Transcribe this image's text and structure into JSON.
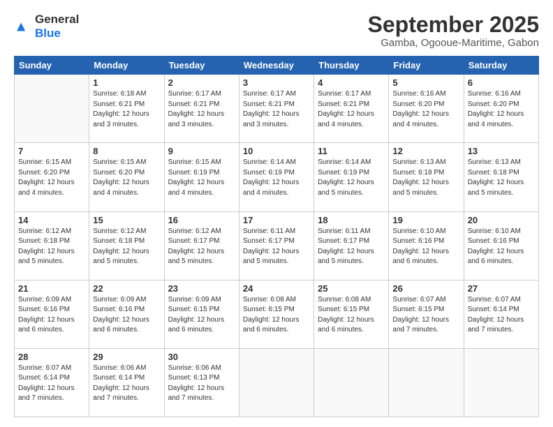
{
  "logo": {
    "general": "General",
    "blue": "Blue"
  },
  "title": "September 2025",
  "subtitle": "Gamba, Ogooue-Maritime, Gabon",
  "days": [
    "Sunday",
    "Monday",
    "Tuesday",
    "Wednesday",
    "Thursday",
    "Friday",
    "Saturday"
  ],
  "weeks": [
    [
      {
        "day": "",
        "info": ""
      },
      {
        "day": "1",
        "info": "Sunrise: 6:18 AM\nSunset: 6:21 PM\nDaylight: 12 hours\nand 3 minutes."
      },
      {
        "day": "2",
        "info": "Sunrise: 6:17 AM\nSunset: 6:21 PM\nDaylight: 12 hours\nand 3 minutes."
      },
      {
        "day": "3",
        "info": "Sunrise: 6:17 AM\nSunset: 6:21 PM\nDaylight: 12 hours\nand 3 minutes."
      },
      {
        "day": "4",
        "info": "Sunrise: 6:17 AM\nSunset: 6:21 PM\nDaylight: 12 hours\nand 4 minutes."
      },
      {
        "day": "5",
        "info": "Sunrise: 6:16 AM\nSunset: 6:20 PM\nDaylight: 12 hours\nand 4 minutes."
      },
      {
        "day": "6",
        "info": "Sunrise: 6:16 AM\nSunset: 6:20 PM\nDaylight: 12 hours\nand 4 minutes."
      }
    ],
    [
      {
        "day": "7",
        "info": "Sunrise: 6:15 AM\nSunset: 6:20 PM\nDaylight: 12 hours\nand 4 minutes."
      },
      {
        "day": "8",
        "info": "Sunrise: 6:15 AM\nSunset: 6:20 PM\nDaylight: 12 hours\nand 4 minutes."
      },
      {
        "day": "9",
        "info": "Sunrise: 6:15 AM\nSunset: 6:19 PM\nDaylight: 12 hours\nand 4 minutes."
      },
      {
        "day": "10",
        "info": "Sunrise: 6:14 AM\nSunset: 6:19 PM\nDaylight: 12 hours\nand 4 minutes."
      },
      {
        "day": "11",
        "info": "Sunrise: 6:14 AM\nSunset: 6:19 PM\nDaylight: 12 hours\nand 5 minutes."
      },
      {
        "day": "12",
        "info": "Sunrise: 6:13 AM\nSunset: 6:18 PM\nDaylight: 12 hours\nand 5 minutes."
      },
      {
        "day": "13",
        "info": "Sunrise: 6:13 AM\nSunset: 6:18 PM\nDaylight: 12 hours\nand 5 minutes."
      }
    ],
    [
      {
        "day": "14",
        "info": "Sunrise: 6:12 AM\nSunset: 6:18 PM\nDaylight: 12 hours\nand 5 minutes."
      },
      {
        "day": "15",
        "info": "Sunrise: 6:12 AM\nSunset: 6:18 PM\nDaylight: 12 hours\nand 5 minutes."
      },
      {
        "day": "16",
        "info": "Sunrise: 6:12 AM\nSunset: 6:17 PM\nDaylight: 12 hours\nand 5 minutes."
      },
      {
        "day": "17",
        "info": "Sunrise: 6:11 AM\nSunset: 6:17 PM\nDaylight: 12 hours\nand 5 minutes."
      },
      {
        "day": "18",
        "info": "Sunrise: 6:11 AM\nSunset: 6:17 PM\nDaylight: 12 hours\nand 5 minutes."
      },
      {
        "day": "19",
        "info": "Sunrise: 6:10 AM\nSunset: 6:16 PM\nDaylight: 12 hours\nand 6 minutes."
      },
      {
        "day": "20",
        "info": "Sunrise: 6:10 AM\nSunset: 6:16 PM\nDaylight: 12 hours\nand 6 minutes."
      }
    ],
    [
      {
        "day": "21",
        "info": "Sunrise: 6:09 AM\nSunset: 6:16 PM\nDaylight: 12 hours\nand 6 minutes."
      },
      {
        "day": "22",
        "info": "Sunrise: 6:09 AM\nSunset: 6:16 PM\nDaylight: 12 hours\nand 6 minutes."
      },
      {
        "day": "23",
        "info": "Sunrise: 6:09 AM\nSunset: 6:15 PM\nDaylight: 12 hours\nand 6 minutes."
      },
      {
        "day": "24",
        "info": "Sunrise: 6:08 AM\nSunset: 6:15 PM\nDaylight: 12 hours\nand 6 minutes."
      },
      {
        "day": "25",
        "info": "Sunrise: 6:08 AM\nSunset: 6:15 PM\nDaylight: 12 hours\nand 6 minutes."
      },
      {
        "day": "26",
        "info": "Sunrise: 6:07 AM\nSunset: 6:15 PM\nDaylight: 12 hours\nand 7 minutes."
      },
      {
        "day": "27",
        "info": "Sunrise: 6:07 AM\nSunset: 6:14 PM\nDaylight: 12 hours\nand 7 minutes."
      }
    ],
    [
      {
        "day": "28",
        "info": "Sunrise: 6:07 AM\nSunset: 6:14 PM\nDaylight: 12 hours\nand 7 minutes."
      },
      {
        "day": "29",
        "info": "Sunrise: 6:06 AM\nSunset: 6:14 PM\nDaylight: 12 hours\nand 7 minutes."
      },
      {
        "day": "30",
        "info": "Sunrise: 6:06 AM\nSunset: 6:13 PM\nDaylight: 12 hours\nand 7 minutes."
      },
      {
        "day": "",
        "info": ""
      },
      {
        "day": "",
        "info": ""
      },
      {
        "day": "",
        "info": ""
      },
      {
        "day": "",
        "info": ""
      }
    ]
  ]
}
